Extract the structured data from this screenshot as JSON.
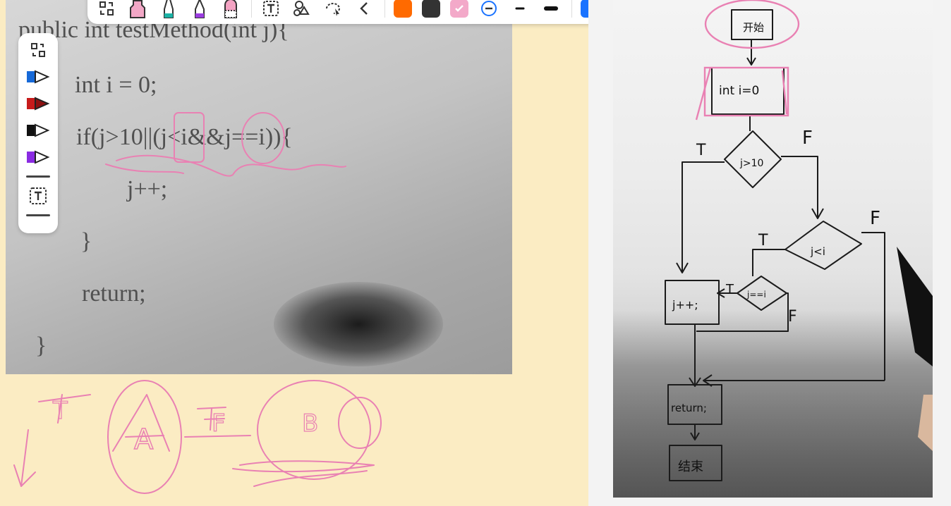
{
  "code": {
    "line1": "public int testMethod(int j){",
    "line2": "int i = 0;",
    "line3": "if(j>10||(j<i&&j==i)){",
    "line4": "j++;",
    "line5": "}",
    "line6": "return;",
    "line7": "}"
  },
  "whiteboard_notes": {
    "t": "T",
    "a": "A",
    "f": "F",
    "b": "B"
  },
  "flowchart": {
    "start": "开始",
    "init": "int i=0",
    "cond1": "j>10",
    "cond2": "j<i",
    "cond3": "j==i",
    "action": "j++;",
    "return": "return;",
    "end": "结束",
    "true_label": "T",
    "false_label": "F"
  },
  "colors": {
    "pink_ink": "#e981b3",
    "orange": "#ff6a00",
    "dark": "#333333",
    "pink": "#f3a9c9",
    "blue": "#1a73ff",
    "page_bg": "#fbecc3"
  },
  "icons": {
    "toolbar": [
      "page-switch-icon",
      "eraser-icon",
      "highlighter-teal-icon",
      "marker-purple-icon",
      "eraser-pink-icon",
      "text-box-icon",
      "shapes-icon",
      "lasso-select-icon",
      "collapse-left-icon",
      "stroke-minus-icon",
      "stroke-thin-icon",
      "stroke-thick-icon",
      "add-color-icon"
    ],
    "side": [
      "page-switch-icon",
      "pen-blue-icon",
      "pen-red-icon",
      "pen-black-icon",
      "pen-purple-icon",
      "text-box-icon"
    ]
  }
}
